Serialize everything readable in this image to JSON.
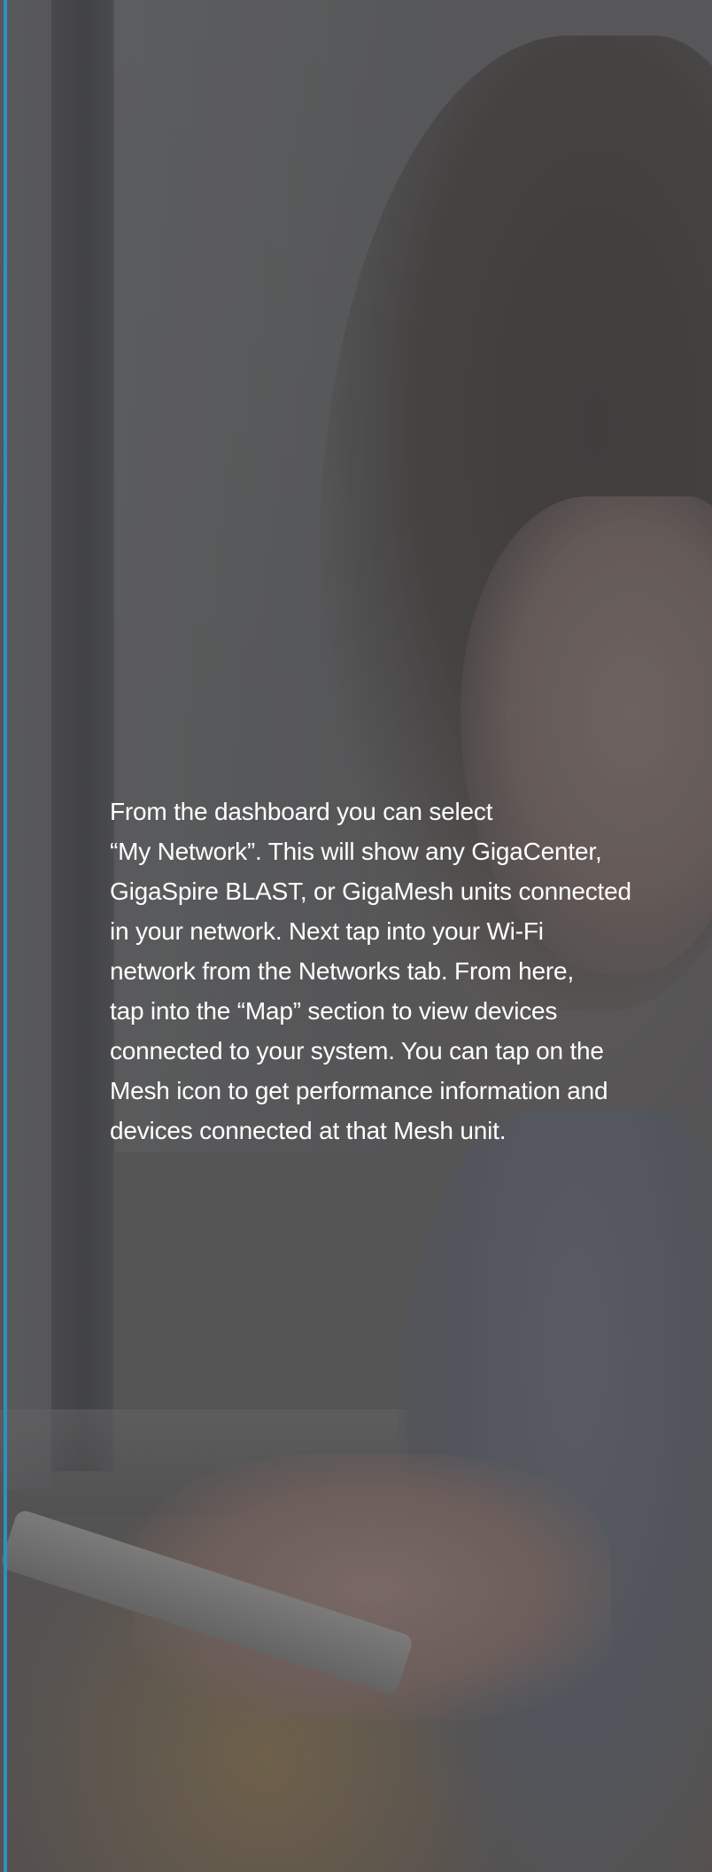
{
  "description_lines": [
    "From the dashboard you can select",
    "“My Network”. This will show any GigaCenter,",
    "GigaSpire BLAST, or GigaMesh units connected",
    "in your network. Next tap into your Wi-Fi",
    "network from the Networks tab. From here,",
    "tap into the “Map” section to view devices",
    "connected to your system. You can tap on the",
    "Mesh icon to get performance information and",
    "devices connected at that Mesh unit."
  ],
  "colors": {
    "accent": "#2f8fc3",
    "text": "#ffffff",
    "background": "#58595b"
  }
}
